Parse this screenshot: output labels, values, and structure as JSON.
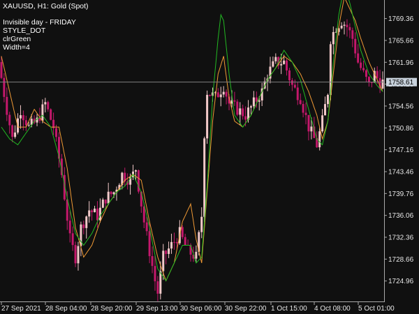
{
  "header": {
    "symbol": "XAUUSD, H1:",
    "instrument": "Gold (Spot)",
    "indicator_lines": [
      "Invisible day - FRIDAY",
      "STYLE_DOT",
      "clrGreen",
      "Width=4"
    ]
  },
  "current_price": "1758.61",
  "colors": {
    "background": "#101010",
    "candle_bull": "#f2c9c9",
    "candle_bear": "#c4186b",
    "line_green": "#22b822",
    "line_orange": "#f09a35",
    "axis": "#aaaaaa",
    "price_line": "#808080",
    "price_tag": "#c8d2dc"
  },
  "chart_data": {
    "type": "candlestick",
    "y_range": [
      1721.5,
      1772.5
    ],
    "y_ticks": [
      "1769.36",
      "1765.66",
      "1761.96",
      "1758.26",
      "1754.56",
      "1750.86",
      "1747.16",
      "1743.46",
      "1739.76",
      "1736.06",
      "1732.36",
      "1728.66",
      "1724.96"
    ],
    "x_ticks": [
      "27 Sep 2021",
      "28 Sep 04:00",
      "28 Sep 20:00",
      "29 Sep 13:00",
      "30 Sep 06:00",
      "30 Sep 22:00",
      "1 Oct 15:00",
      "4 Oct 08:00",
      "5 Oct 01:00"
    ],
    "bar_count": 140,
    "candle_anchors": [
      [
        0,
        1762
      ],
      [
        3,
        1754
      ],
      [
        5,
        1749
      ],
      [
        8,
        1754
      ],
      [
        11,
        1751
      ],
      [
        14,
        1752
      ],
      [
        17,
        1755
      ],
      [
        20,
        1751
      ],
      [
        23,
        1743
      ],
      [
        26,
        1732
      ],
      [
        28,
        1729
      ],
      [
        30,
        1734
      ],
      [
        33,
        1737
      ],
      [
        36,
        1736
      ],
      [
        39,
        1739
      ],
      [
        42,
        1740
      ],
      [
        45,
        1743
      ],
      [
        48,
        1742
      ],
      [
        50,
        1744
      ],
      [
        53,
        1735
      ],
      [
        55,
        1730
      ],
      [
        57,
        1725
      ],
      [
        58,
        1723
      ],
      [
        60,
        1729
      ],
      [
        63,
        1731
      ],
      [
        66,
        1733
      ],
      [
        69,
        1730
      ],
      [
        72,
        1729
      ],
      [
        74,
        1736
      ],
      [
        75,
        1750
      ],
      [
        76,
        1757
      ],
      [
        79,
        1756
      ],
      [
        82,
        1758
      ],
      [
        84,
        1755
      ],
      [
        87,
        1754
      ],
      [
        90,
        1753
      ],
      [
        93,
        1755
      ],
      [
        96,
        1757
      ],
      [
        98,
        1760
      ],
      [
        101,
        1762
      ],
      [
        104,
        1762
      ],
      [
        107,
        1758
      ],
      [
        110,
        1756
      ],
      [
        113,
        1751
      ],
      [
        116,
        1748
      ],
      [
        118,
        1752
      ],
      [
        120,
        1757
      ],
      [
        121,
        1766
      ],
      [
        123,
        1768
      ],
      [
        125,
        1769
      ],
      [
        127,
        1768
      ],
      [
        129,
        1766
      ],
      [
        131,
        1762
      ],
      [
        133,
        1760
      ],
      [
        135,
        1758
      ],
      [
        137,
        1760
      ],
      [
        139,
        1758.6
      ]
    ],
    "green_line_anchors": [
      [
        0,
        1751
      ],
      [
        3,
        1749
      ],
      [
        6,
        1748
      ],
      [
        9,
        1750
      ],
      [
        12,
        1752
      ],
      [
        15,
        1753
      ],
      [
        18,
        1751
      ],
      [
        21,
        1746
      ],
      [
        24,
        1739
      ],
      [
        27,
        1733
      ],
      [
        30,
        1731
      ],
      [
        33,
        1733
      ],
      [
        36,
        1736
      ],
      [
        39,
        1738
      ],
      [
        42,
        1740
      ],
      [
        45,
        1741
      ],
      [
        48,
        1743
      ],
      [
        51,
        1740
      ],
      [
        54,
        1734
      ],
      [
        57,
        1727
      ],
      [
        60,
        1725
      ],
      [
        63,
        1728
      ],
      [
        66,
        1731
      ],
      [
        69,
        1731
      ],
      [
        71,
        1728
      ],
      [
        73,
        1729
      ],
      [
        75,
        1741
      ],
      [
        77,
        1756
      ],
      [
        79,
        1766
      ],
      [
        80,
        1770
      ],
      [
        81,
        1769
      ],
      [
        83,
        1760
      ],
      [
        85,
        1753
      ],
      [
        88,
        1751
      ],
      [
        91,
        1753
      ],
      [
        94,
        1756
      ],
      [
        97,
        1759
      ],
      [
        100,
        1761
      ],
      [
        103,
        1764
      ],
      [
        106,
        1762
      ],
      [
        109,
        1759
      ],
      [
        112,
        1754
      ],
      [
        115,
        1749
      ],
      [
        117,
        1748
      ],
      [
        119,
        1752
      ],
      [
        121,
        1762
      ],
      [
        123,
        1770
      ],
      [
        125,
        1775
      ],
      [
        127,
        1772
      ],
      [
        129,
        1768
      ],
      [
        131,
        1764
      ],
      [
        134,
        1760
      ],
      [
        137,
        1758
      ],
      [
        139,
        1757
      ]
    ],
    "orange_line_anchors": [
      [
        0,
        1763
      ],
      [
        3,
        1757
      ],
      [
        6,
        1751
      ],
      [
        9,
        1751
      ],
      [
        12,
        1754
      ],
      [
        15,
        1752
      ],
      [
        18,
        1751
      ],
      [
        21,
        1751
      ],
      [
        24,
        1744
      ],
      [
        27,
        1734
      ],
      [
        30,
        1729
      ],
      [
        33,
        1731
      ],
      [
        36,
        1735
      ],
      [
        39,
        1738
      ],
      [
        42,
        1740
      ],
      [
        45,
        1742
      ],
      [
        48,
        1743
      ],
      [
        51,
        1742
      ],
      [
        54,
        1735
      ],
      [
        57,
        1729
      ],
      [
        60,
        1725
      ],
      [
        63,
        1728
      ],
      [
        66,
        1735
      ],
      [
        69,
        1738
      ],
      [
        71,
        1732
      ],
      [
        73,
        1728
      ],
      [
        75,
        1740
      ],
      [
        77,
        1752
      ],
      [
        79,
        1760
      ],
      [
        81,
        1763
      ],
      [
        83,
        1756
      ],
      [
        85,
        1752
      ],
      [
        88,
        1751
      ],
      [
        91,
        1753
      ],
      [
        94,
        1756
      ],
      [
        97,
        1759
      ],
      [
        100,
        1761
      ],
      [
        103,
        1763
      ],
      [
        106,
        1762
      ],
      [
        109,
        1760
      ],
      [
        112,
        1757
      ],
      [
        115,
        1753
      ],
      [
        117,
        1749
      ],
      [
        119,
        1752
      ],
      [
        121,
        1760
      ],
      [
        123,
        1768
      ],
      [
        125,
        1773
      ],
      [
        127,
        1771
      ],
      [
        129,
        1769
      ],
      [
        131,
        1766
      ],
      [
        134,
        1762
      ],
      [
        137,
        1759
      ],
      [
        139,
        1757
      ]
    ]
  }
}
